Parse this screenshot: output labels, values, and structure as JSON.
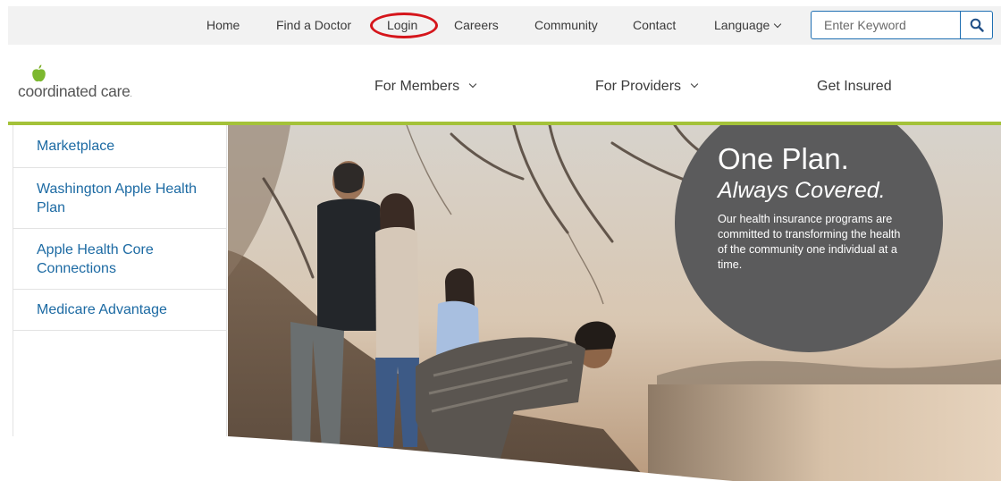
{
  "utility_nav": {
    "items": [
      "Home",
      "Find a Doctor",
      "Login",
      "Careers",
      "Community",
      "Contact"
    ],
    "language_label": "Language",
    "search_placeholder": "Enter Keyword"
  },
  "annotation": {
    "highlighted_item": "Login",
    "ring_color": "#d5151b"
  },
  "logo": {
    "text": "coordinated care",
    "mark": "."
  },
  "main_nav": {
    "items": [
      "For Members",
      "For Providers",
      "Get Insured"
    ]
  },
  "sidebar": {
    "items": [
      "Marketplace",
      "Washington Apple Health Plan",
      "Apple Health Core Connections",
      "Medicare Advantage"
    ]
  },
  "hero": {
    "headline": "One Plan.",
    "tagline": "Always Covered.",
    "body": "Our health insurance programs are committed to transforming the health of the community one individual at a time."
  },
  "colors": {
    "accent_green": "#a4c239",
    "link_blue": "#1c6aa3",
    "search_blue": "#1f6fb2",
    "promo_circle": "#5b5b5c",
    "utility_bar": "#f2f2f2"
  },
  "icons": {
    "search": "search-icon",
    "language_dropdown": "chevron-down-icon",
    "nav_dropdown": "chevron-down-icon",
    "logo": "apple-logo-icon"
  }
}
